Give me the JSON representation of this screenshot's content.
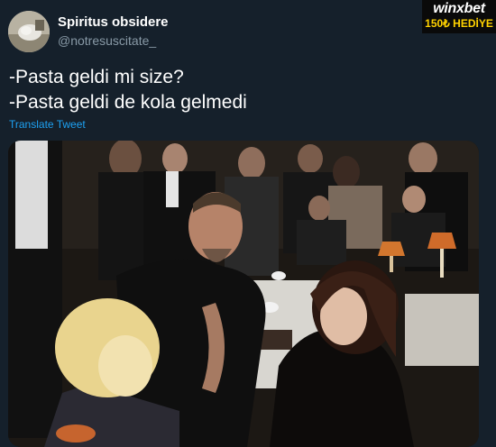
{
  "tweet": {
    "author": {
      "name": "Spiritus obsidere",
      "handle": "@notresuscitate_"
    },
    "text_lines": [
      "-Pasta geldi mi size?",
      "-Pasta geldi de kola gelmedi"
    ],
    "translate_label": "Translate Tweet",
    "media": {
      "kind": "photo"
    }
  },
  "brand_overlay": {
    "logo_text": "winxbet",
    "promo_text": "150₺ HEDİYE"
  },
  "colors": {
    "background": "#15202b",
    "text": "#ffffff",
    "secondary_text": "#8899a6",
    "link": "#1da1f2",
    "promo": "#ffd200"
  },
  "icons": {
    "avatar": "profile-photo"
  }
}
